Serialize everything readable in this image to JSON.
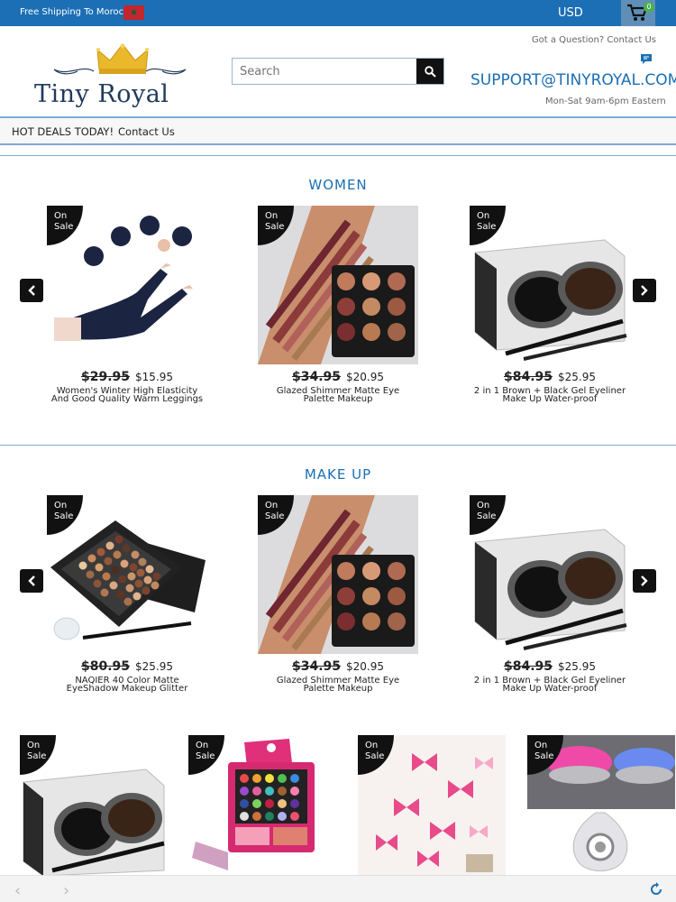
{
  "topbar": {
    "shipping_text": "Free Shipping To Morocco",
    "currency": "USD",
    "cart_count": "0",
    "flag_icon": "morocco-flag-icon",
    "cart_icon": "cart-icon"
  },
  "header": {
    "logo_text": "Tiny Royal",
    "search_placeholder": "Search",
    "question_text": "Got a Question? Contact Us",
    "support_email": "SUPPORT@TINYROYAL.COM",
    "hours": "Mon-Sat 9am-6pm Eastern"
  },
  "nav": {
    "items": [
      "HOT DEALS TODAY!",
      "Contact Us"
    ]
  },
  "badge_text": {
    "line1": "On",
    "line2": "Sale"
  },
  "women": {
    "title": "WOMEN",
    "products": [
      {
        "old_price": "$29.95",
        "new_price": "$15.95",
        "name": "Women's Winter High Elasticity And Good Quality Warm Leggings"
      },
      {
        "old_price": "$34.95",
        "new_price": "$20.95",
        "name": "Glazed Shimmer Matte Eye Palette Makeup"
      },
      {
        "old_price": "$84.95",
        "new_price": "$25.95",
        "name": "2 in 1 Brown + Black Gel Eyeliner Make Up Water-proof"
      }
    ]
  },
  "makeup": {
    "title": "MAKE UP",
    "products": [
      {
        "old_price": "$80.95",
        "new_price": "$25.95",
        "name": "NAQIER 40 Color Matte EyeShadow Makeup Glitter"
      },
      {
        "old_price": "$34.95",
        "new_price": "$20.95",
        "name": "Glazed Shimmer Matte Eye Palette Makeup"
      },
      {
        "old_price": "$84.95",
        "new_price": "$25.95",
        "name": "2 in 1 Brown + Black Gel Eyeliner Make Up Water-proof"
      }
    ]
  },
  "colors": {
    "brand_blue": "#1c6fb4",
    "badge": "#111111"
  }
}
